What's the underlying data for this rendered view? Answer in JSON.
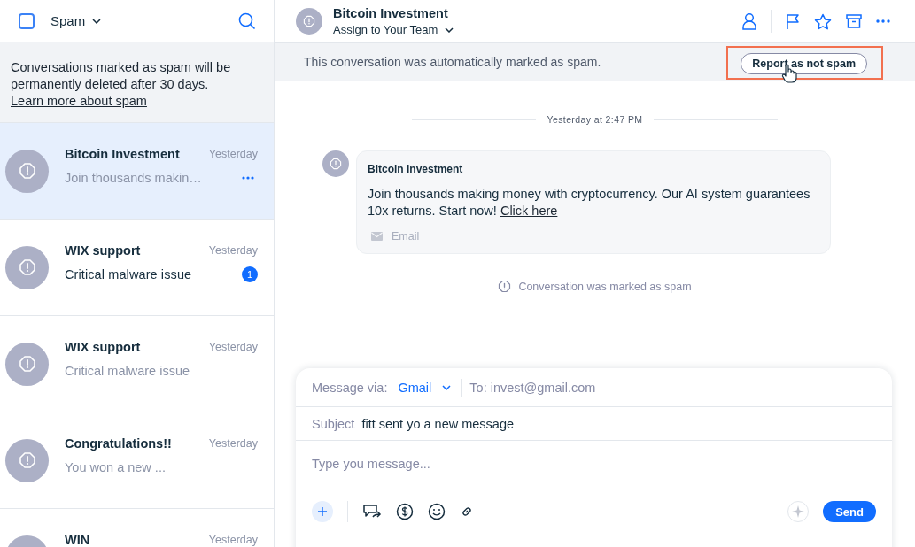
{
  "sidebar": {
    "select_all_checked": false,
    "folder": "Spam",
    "notice": "Conversations marked as spam will be permanently deleted after 30 days.",
    "notice_link": "Learn more about spam",
    "conversations": [
      {
        "name": "Bitcoin Investment",
        "time": "Yesterday",
        "preview": "Join thousands makin…",
        "selected": true,
        "unread": false
      },
      {
        "name": "WIX support",
        "time": "Yesterday",
        "preview": "Critical malware issue",
        "selected": false,
        "unread": true,
        "badge": "1"
      },
      {
        "name": "WIX support",
        "time": "Yesterday",
        "preview": "Critical malware issue",
        "selected": false,
        "unread": false
      },
      {
        "name": "Congratulations!!",
        "time": "Yesterday",
        "preview": "You won a new ...",
        "selected": false,
        "unread": false
      },
      {
        "name": "WIN",
        "time": "Yesterday",
        "selected": false
      }
    ]
  },
  "conversation": {
    "title": "Bitcoin Investment",
    "assign": "Assign to Your Team",
    "banner": "This conversation was automatically marked as spam.",
    "report_button": "Report as not spam",
    "report_highlighted": true,
    "timestamp": "Yesterday at 2:47 PM",
    "message": {
      "sender": "Bitcoin Investment",
      "body": "Join thousands making money with cryptocurrency. Our AI system guarantees 10x returns. Start now!",
      "link": "Click here",
      "channel": "Email"
    },
    "status": "Conversation was marked as spam"
  },
  "composer": {
    "via_label": "Message via:",
    "via": "Gmail",
    "to": "To: invest@gmail.com",
    "subject_label": "Subject",
    "subject": "fitt sent yo a new message",
    "placeholder": "Type you message...",
    "send": "Send"
  }
}
